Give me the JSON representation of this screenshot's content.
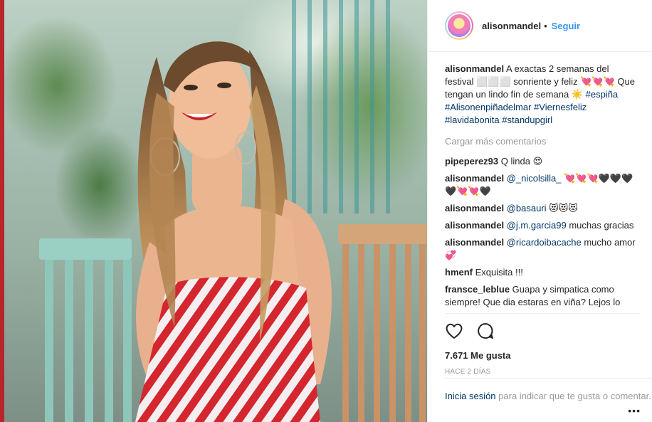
{
  "header": {
    "username": "alisonmandel",
    "dot": "•",
    "follow_label": "Seguir"
  },
  "caption": {
    "username": "alisonmandel",
    "text": "A exactas 2 semanas del festival ⬜⬜⬜ sonriente y feliz 💘💘💘 Que tengan un lindo fin de semana ☀️",
    "hashtags": [
      "#espiña",
      "#Alisonenpiñadelmar",
      "#Viernesfeliz",
      "#lavidabonita",
      "#standupgirl"
    ]
  },
  "load_more": "Cargar más comentarios",
  "comments": [
    {
      "user": "pipeperez93",
      "text": "Q linda 😍"
    },
    {
      "user": "alisonmandel",
      "mention": "@_nicolsilla_",
      "text": "💘💘💘🖤🖤🖤🖤💘💘🖤"
    },
    {
      "user": "alisonmandel",
      "mention": "@basauri",
      "text": "😻😻😻"
    },
    {
      "user": "alisonmandel",
      "mention": "@j.m.garcia99",
      "text": "muchas gracias"
    },
    {
      "user": "alisonmandel",
      "mention": "@ricardoibacache",
      "text": "mucho amor 💞"
    },
    {
      "user": "hmenf",
      "text": "Exquisita !!!"
    },
    {
      "user": "fransce_leblue",
      "text": "Guapa y simpatica como siempre! Que dia estaras en viña? Lejos lo"
    }
  ],
  "actions": {
    "like_icon": "heart-icon",
    "comment_icon": "comment-icon",
    "likes_text": "7.671 Me gusta",
    "time_text": "HACE 2 DÍAS",
    "login_link": "Inicia sesión",
    "login_rest": "para indicar que te gusta o comentar.",
    "more_label": "•••"
  }
}
